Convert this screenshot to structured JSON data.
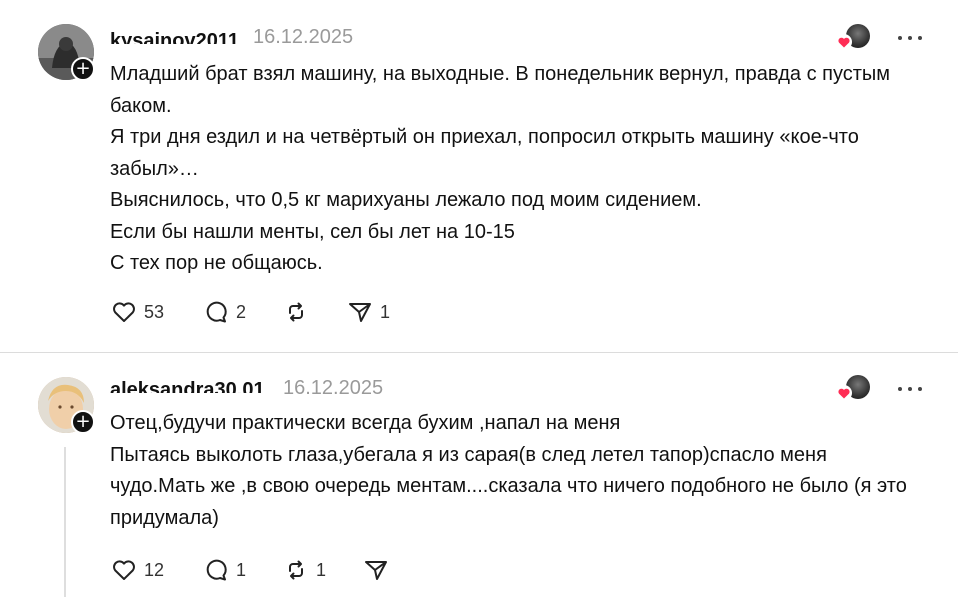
{
  "posts": [
    {
      "username": "kysainov2011",
      "date": "16.12.2025",
      "lines": [
        "Младший брат взял машину, на выходные. В понедельник вернул, правда с пустым баком.",
        "Я три дня ездил и на четвёртый он приехал, попросил открыть машину «кое-что забыл»…",
        "Выяснилось, что 0,5 кг марихуаны лежало под моим сидением.",
        "Если бы нашли менты, сел бы лет на 10-15",
        "С тех пор не общаюсь."
      ],
      "likes": "53",
      "replies": "2",
      "reposts": "",
      "shares": "1"
    },
    {
      "username": "aleksandra30.01",
      "date": "16.12.2025",
      "lines": [
        "Отец,будучи практически всегда бухим ,напал на меня",
        "Пытаясь выколоть глаза,убегала я из сарая(в след летел тапор)спасло меня чудо.Мать же ,в свою очередь ментам....сказала что ничего подобного не было (я это придумала)"
      ],
      "likes": "12",
      "replies": "1",
      "reposts": "1",
      "shares": ""
    }
  ],
  "icons": {
    "like": "heart-outline-icon",
    "reply": "speech-bubble-icon",
    "repost": "repost-arrows-icon",
    "share": "paper-plane-icon",
    "more": "ellipsis-icon",
    "follow": "plus-icon",
    "liked": "red-heart-icon"
  },
  "colors": {
    "liked_heart": "#ff2d55",
    "date": "#9a9a9a",
    "divider": "#dcdcdc"
  }
}
